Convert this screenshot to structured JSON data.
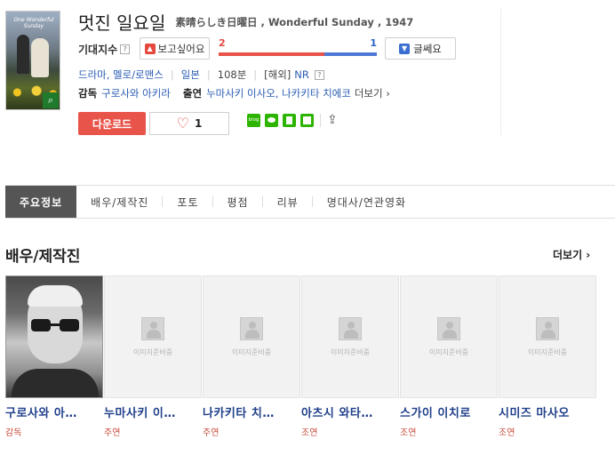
{
  "movie": {
    "title_ko": "멋진 일요일",
    "title_orig": "素晴らしき日曜日 , Wonderful Sunday , 1947",
    "poster_caption": "One Wonderful Sunday"
  },
  "expectation": {
    "label": "기대지수",
    "want_label": "보고싶어요",
    "want_count": "2",
    "dislike_label": "글쎄요",
    "dislike_count": "1",
    "want_ratio": 0.667
  },
  "meta": {
    "genre": "드라마, 멜로/로맨스",
    "country": "일본",
    "runtime": "108분",
    "rating_prefix": "[해외]",
    "rating": "NR"
  },
  "crew": {
    "director_label": "감독",
    "director": "구로사와 아키라",
    "cast_label": "출연",
    "cast": "누마사키 이사오, 나카키타 치에코",
    "more_label": "더보기 ›"
  },
  "actions": {
    "download_label": "다운로드",
    "like_count": "1",
    "blog_label": "blog"
  },
  "tabs": [
    {
      "label": "주요정보"
    },
    {
      "label": "배우/제작진"
    },
    {
      "label": "포토"
    },
    {
      "label": "평점"
    },
    {
      "label": "리뷰"
    },
    {
      "label": "명대사/연관영화"
    }
  ],
  "cast_section": {
    "title": "배우/제작진",
    "more_label": "더보기 ›",
    "placeholder_text": "이미지준비중",
    "people": [
      {
        "name": "구로사와 아…",
        "role": "감독"
      },
      {
        "name": "누마사키 이…",
        "role": "주연"
      },
      {
        "name": "나카키타 치…",
        "role": "주연"
      },
      {
        "name": "아츠시 와타…",
        "role": "조연"
      },
      {
        "name": "스가이 이치로",
        "role": "조연"
      },
      {
        "name": "시미즈 마사오",
        "role": "조연"
      }
    ]
  },
  "colors": {
    "accent_red": "#e8534a",
    "link_blue": "#2b5db4",
    "name_blue": "#1f3f8a",
    "share_green": "#2db400"
  }
}
